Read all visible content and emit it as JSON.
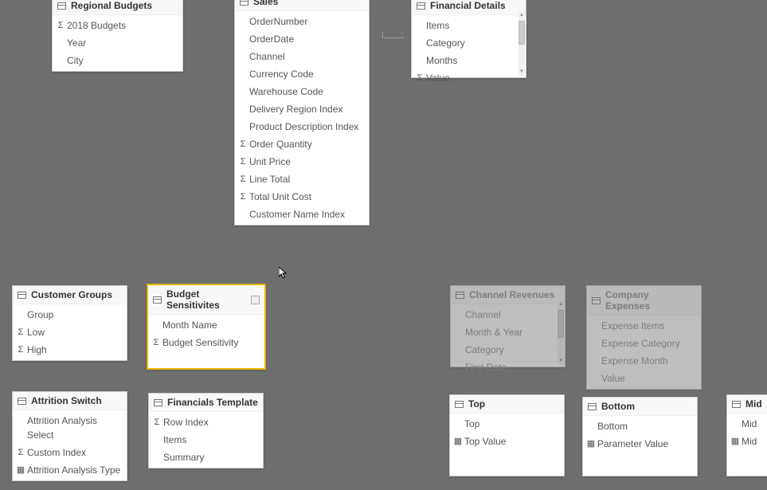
{
  "tables": {
    "regionalBudgets": {
      "title": "Regional Budgets",
      "fields": [
        {
          "label": "2018 Budgets",
          "icon": "Σ"
        },
        {
          "label": "Year",
          "icon": ""
        },
        {
          "label": "City",
          "icon": ""
        }
      ]
    },
    "sales": {
      "title": "Sales",
      "fields": [
        {
          "label": "OrderNumber",
          "icon": ""
        },
        {
          "label": "OrderDate",
          "icon": ""
        },
        {
          "label": "Channel",
          "icon": ""
        },
        {
          "label": "Currency Code",
          "icon": ""
        },
        {
          "label": "Warehouse Code",
          "icon": ""
        },
        {
          "label": "Delivery Region Index",
          "icon": ""
        },
        {
          "label": "Product Description Index",
          "icon": ""
        },
        {
          "label": "Order Quantity",
          "icon": "Σ"
        },
        {
          "label": "Unit Price",
          "icon": "Σ"
        },
        {
          "label": "Line Total",
          "icon": "Σ"
        },
        {
          "label": "Total Unit Cost",
          "icon": "Σ"
        },
        {
          "label": "Customer Name Index",
          "icon": ""
        }
      ]
    },
    "financialDetails": {
      "title": "Financial Details",
      "fields": [
        {
          "label": "Items",
          "icon": ""
        },
        {
          "label": "Category",
          "icon": ""
        },
        {
          "label": "Months",
          "icon": ""
        },
        {
          "label": "Value",
          "icon": "Σ"
        }
      ]
    },
    "customerGroups": {
      "title": "Customer Groups",
      "fields": [
        {
          "label": "Group",
          "icon": ""
        },
        {
          "label": "Low",
          "icon": "Σ"
        },
        {
          "label": "High",
          "icon": "Σ"
        }
      ]
    },
    "budgetSensitivities": {
      "title": "Budget Sensitivites",
      "fields": [
        {
          "label": "Month Name",
          "icon": ""
        },
        {
          "label": "Budget Sensitivity",
          "icon": "Σ"
        }
      ]
    },
    "channelRevenues": {
      "title": "Channel Revenues",
      "fields": [
        {
          "label": "Channel",
          "icon": ""
        },
        {
          "label": "Month & Year",
          "icon": ""
        },
        {
          "label": "Category",
          "icon": ""
        },
        {
          "label": "First Date",
          "icon": ""
        }
      ]
    },
    "companyExpenses": {
      "title": "Company Expenses",
      "fields": [
        {
          "label": "Expense Items",
          "icon": ""
        },
        {
          "label": "Expense Category",
          "icon": ""
        },
        {
          "label": "Expense Month",
          "icon": ""
        },
        {
          "label": "Value",
          "icon": ""
        }
      ]
    },
    "attritionSwitch": {
      "title": "Attrition Switch",
      "fields": [
        {
          "label": "Attrition Analysis Select",
          "icon": ""
        },
        {
          "label": "Custom Index",
          "icon": "Σ"
        },
        {
          "label": "Attrition Analysis Type",
          "icon": "▦"
        }
      ]
    },
    "financialsTemplate": {
      "title": "Financials Template",
      "fields": [
        {
          "label": "Row Index",
          "icon": "Σ"
        },
        {
          "label": "Items",
          "icon": ""
        },
        {
          "label": "Summary",
          "icon": ""
        }
      ]
    },
    "top": {
      "title": "Top",
      "fields": [
        {
          "label": "Top",
          "icon": ""
        },
        {
          "label": "Top Value",
          "icon": "▦"
        }
      ]
    },
    "bottom": {
      "title": "Bottom",
      "fields": [
        {
          "label": "Bottom",
          "icon": ""
        },
        {
          "label": "Parameter Value",
          "icon": "▦"
        }
      ]
    },
    "mid": {
      "title": "Mid",
      "fields": [
        {
          "label": "Mid",
          "icon": ""
        },
        {
          "label": "Mid",
          "icon": "▦"
        }
      ]
    }
  }
}
